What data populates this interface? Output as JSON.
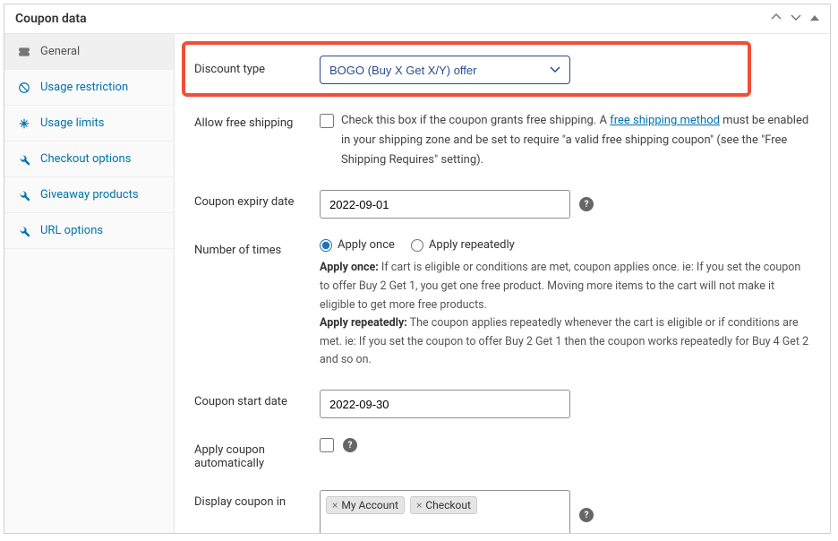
{
  "panel": {
    "title": "Coupon data"
  },
  "sidebar": {
    "items": [
      {
        "label": "General"
      },
      {
        "label": "Usage restriction"
      },
      {
        "label": "Usage limits"
      },
      {
        "label": "Checkout options"
      },
      {
        "label": "Giveaway products"
      },
      {
        "label": "URL options"
      }
    ]
  },
  "form": {
    "discount_type": {
      "label": "Discount type",
      "selected": "BOGO (Buy X Get X/Y) offer"
    },
    "free_shipping": {
      "label": "Allow free shipping",
      "text_before_link": "Check this box if the coupon grants free shipping. A ",
      "link_text": "free shipping method",
      "text_after_link": " must be enabled in your shipping zone and be set to require \"a valid free shipping coupon\" (see the \"Free Shipping Requires\" setting)."
    },
    "expiry": {
      "label": "Coupon expiry date",
      "value": "2022-09-01"
    },
    "times": {
      "label": "Number of times",
      "opt1": "Apply once",
      "opt2": "Apply repeatedly",
      "desc1_label": "Apply once:",
      "desc1": " If cart is eligible or conditions are met, coupon applies once. ie: If you set the coupon to offer Buy 2 Get 1, you get one free product. Moving more items to the cart will not make it eligible to get more free products.",
      "desc2_label": "Apply repeatedly:",
      "desc2": " The coupon applies repeatedly whenever the cart is eligible or if conditions are met. ie: If you set the coupon to offer Buy 2 Get 1 then the coupon works repeatedly for Buy 4 Get 2 and so on."
    },
    "start": {
      "label": "Coupon start date",
      "value": "2022-09-30"
    },
    "auto": {
      "label": "Apply coupon automatically"
    },
    "display_in": {
      "label": "Display coupon in",
      "tag1": "My Account",
      "tag2": "Checkout"
    }
  }
}
